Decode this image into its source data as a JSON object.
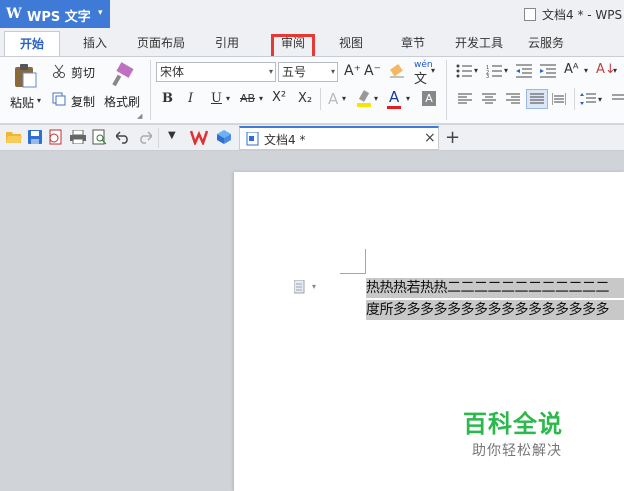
{
  "app": {
    "logo": "W",
    "name": "WPS 文字",
    "dropdown": "▾"
  },
  "window_title": "文档4 * - WPS",
  "tabs": [
    "开始",
    "插入",
    "页面布局",
    "引用",
    "审阅",
    "视图",
    "章节",
    "开发工具",
    "云服务"
  ],
  "ribbon": {
    "paste": "粘贴",
    "cut": "剪切",
    "copy": "复制",
    "format_painter": "格式刷",
    "font_name": "宋体",
    "font_size": "五号",
    "bold": "B",
    "italic": "I",
    "underline": "U",
    "strike": "AB",
    "superscript": "X²",
    "subscript": "X₂",
    "grow": "A⁺",
    "shrink": "A⁻",
    "pinyin": "wén"
  },
  "doc_tab": {
    "label": "文档4 *",
    "close": "×",
    "new": "+"
  },
  "document": {
    "lines": [
      "热热热若热热二二二二二二二二二二二二",
      "度所多多多多多多多多多多多多多多多多"
    ]
  },
  "watermark": {
    "title": "百科全说",
    "subtitle": "助你轻松解决"
  },
  "colors": {
    "accent": "#3e7ad6",
    "highlight_box": "#e53935",
    "watermark_green": "#2db84d"
  }
}
